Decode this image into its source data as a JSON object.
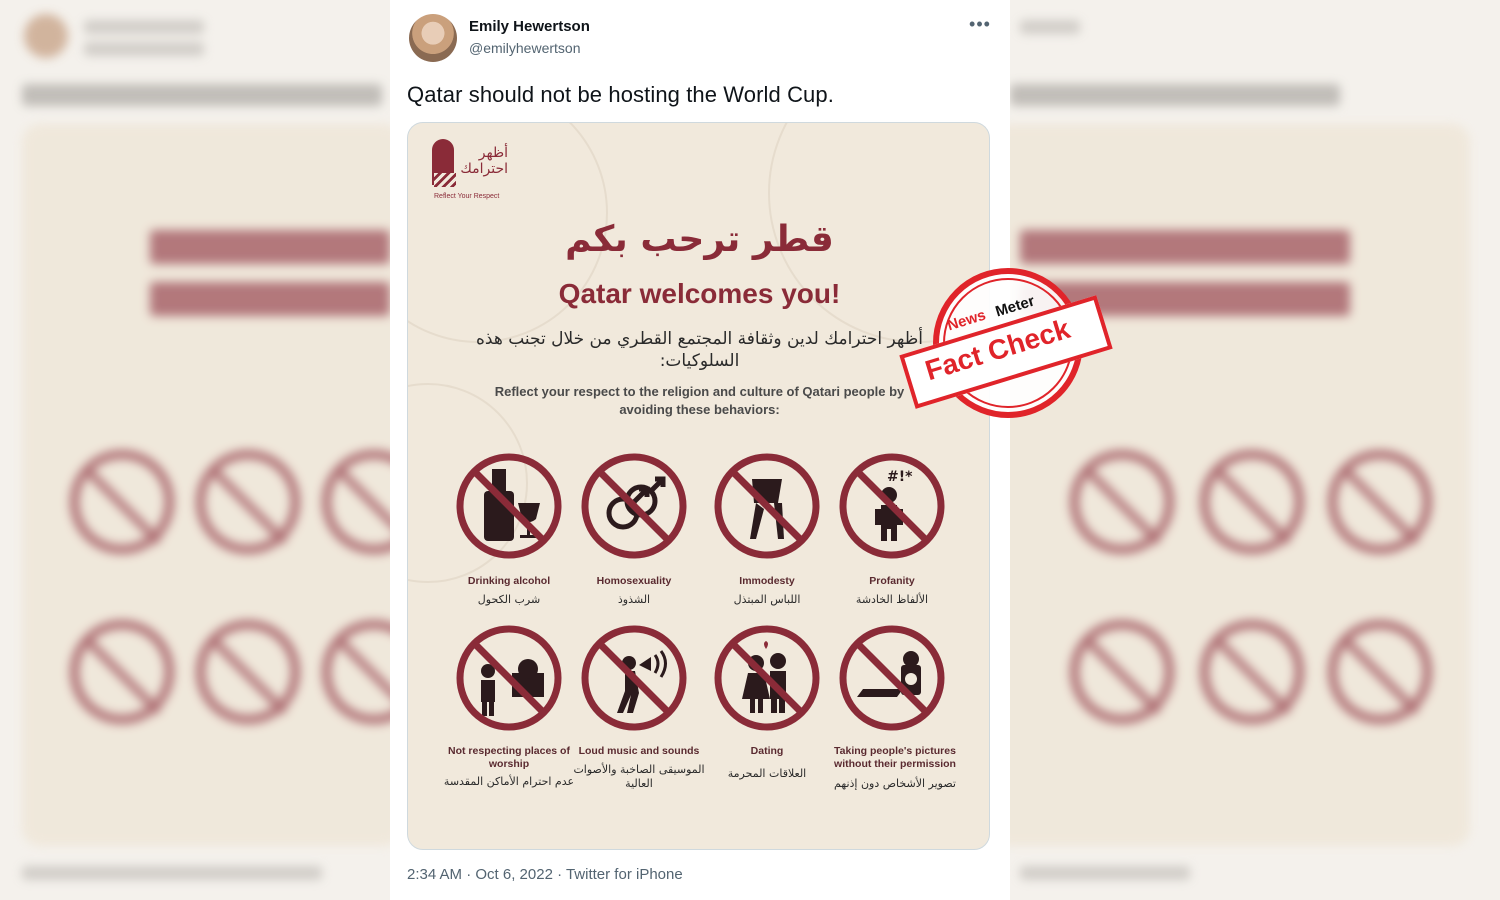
{
  "tweet": {
    "author_name": "Emily Hewertson",
    "author_handle": "@emilyhewertson",
    "text": "Qatar should not be hosting the World Cup.",
    "timestamp": "2:34 AM · Oct 6, 2022 · Twitter for iPhone",
    "more_icon": "ellipsis-icon"
  },
  "poster": {
    "logo_ar": "أظهر احترامك",
    "logo_en": "Reflect Your Respect",
    "title_ar": "قطر ترحب بكم",
    "title_en": "Qatar welcomes you!",
    "intro_ar": "أظهر احترامك لدين وثقافة المجتمع القطري من خلال تجنب هذه السلوكيات:",
    "intro_en": "Reflect your respect to the religion and culture of Qatari people by avoiding these behaviors:",
    "signs": [
      {
        "en": "Drinking alcohol",
        "ar": "شرب الكحول",
        "icon": "no-alcohol-icon"
      },
      {
        "en": "Homosexuality",
        "ar": "الشذوذ",
        "icon": "no-homosexuality-icon"
      },
      {
        "en": "Immodesty",
        "ar": "اللباس المبتذل",
        "icon": "no-immodesty-icon"
      },
      {
        "en": "Profanity",
        "ar": "الألفاظ الخادشة",
        "icon": "no-profanity-icon"
      },
      {
        "en": "Not respecting places of worship",
        "ar": "عدم احترام الأماكن المقدسة",
        "icon": "no-disrespect-worship-icon"
      },
      {
        "en": "Loud music and sounds",
        "ar": "الموسيقى الصاخبة والأصوات العالية",
        "icon": "no-loud-music-icon"
      },
      {
        "en": "Dating",
        "ar": "العلاقات المحرمة",
        "icon": "no-dating-icon"
      },
      {
        "en": "Taking people's pictures without their permission",
        "ar": "تصوير الأشخاص دون إذنهم",
        "icon": "no-photos-icon"
      }
    ]
  },
  "stamp": {
    "news": "News",
    "meter": "Meter",
    "label": "Fact Check"
  },
  "colors": {
    "brand": "#8a2b38",
    "stamp_red": "#e0242a"
  }
}
